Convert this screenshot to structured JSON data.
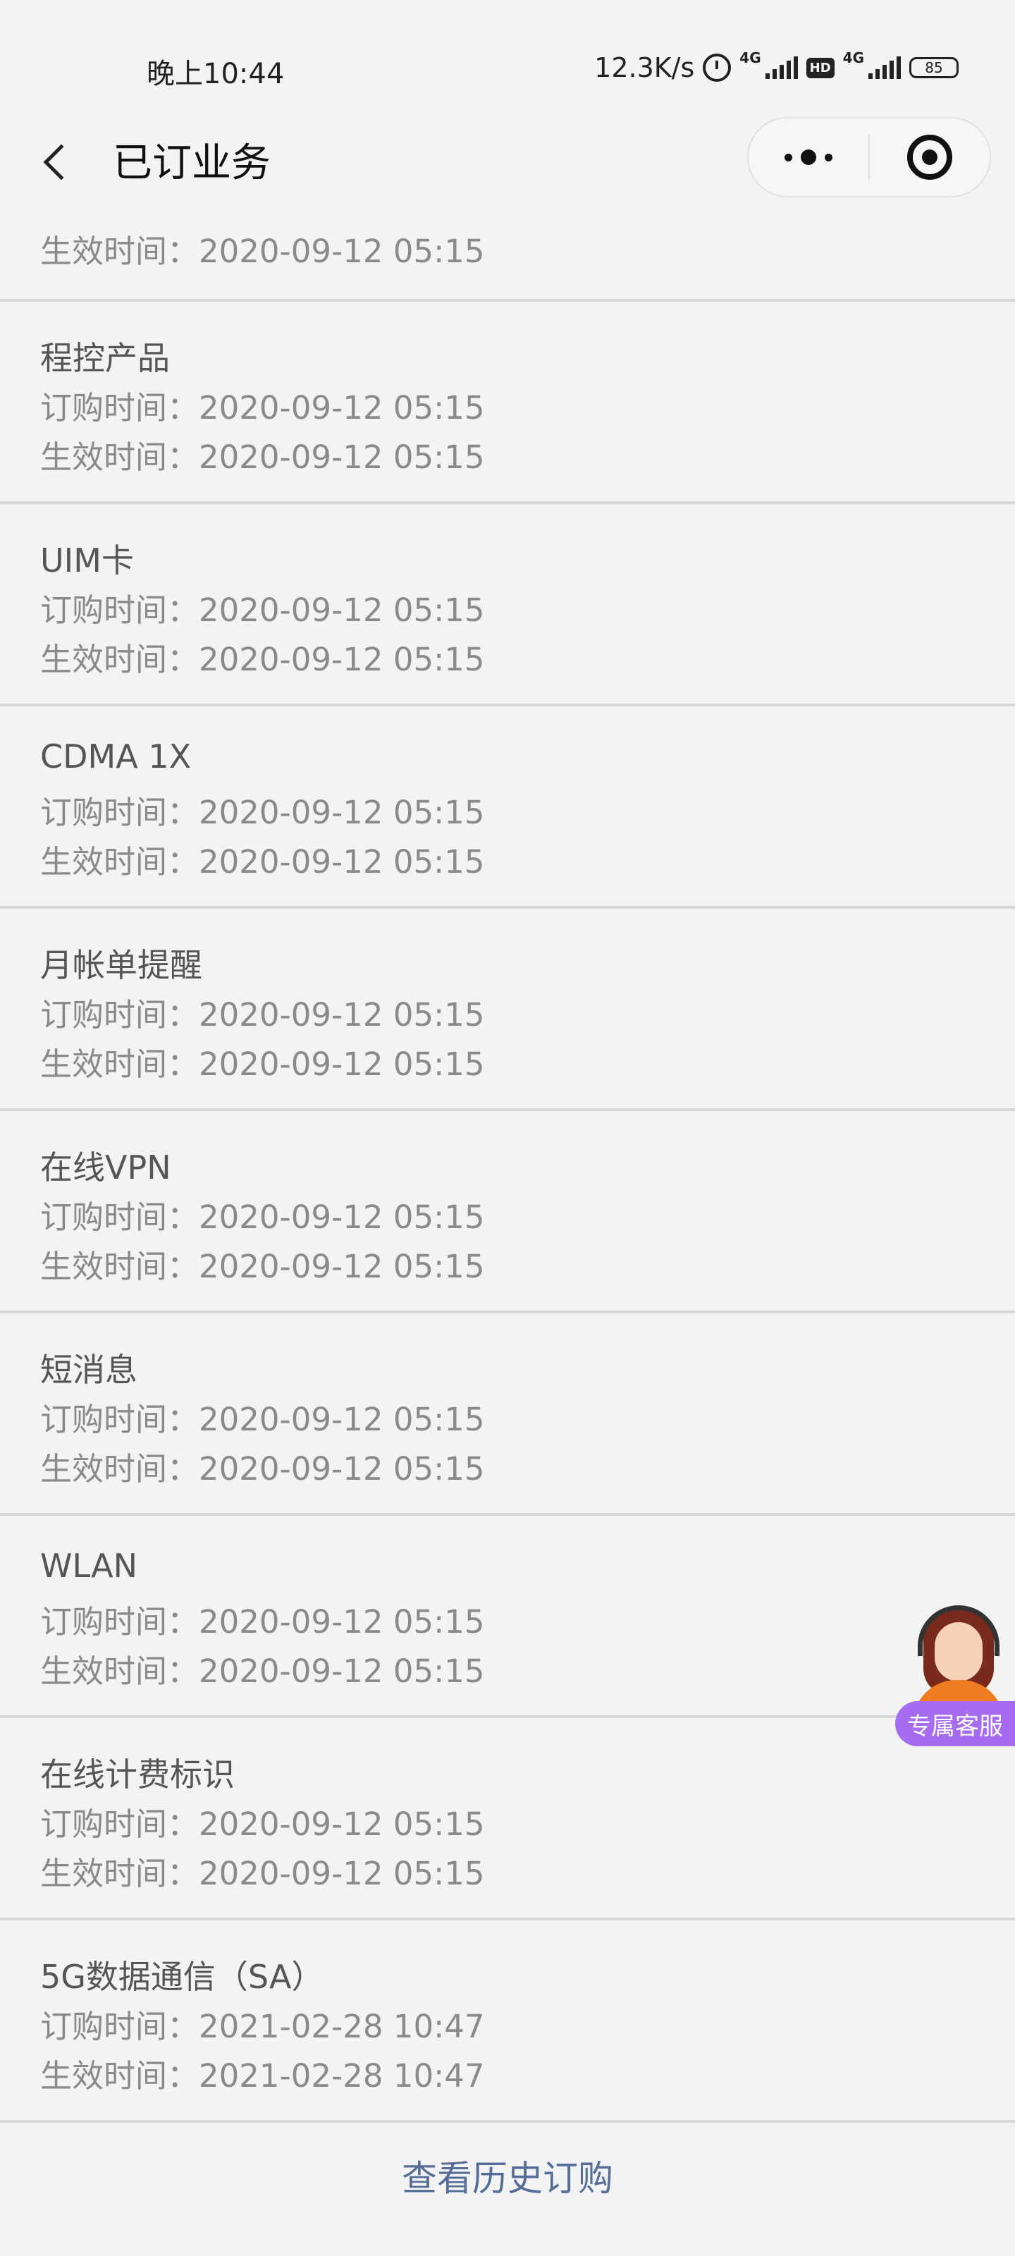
{
  "status_bar": {
    "time": "晚上10:44",
    "net_speed": "12.3K/s",
    "net_type_1": "4G",
    "hd": "HD",
    "net_type_2": "4G",
    "battery": "85"
  },
  "header": {
    "title": "已订业务"
  },
  "list": {
    "partial": {
      "effect": "生效时间：2020-09-12 05:15"
    },
    "items": [
      {
        "name": "程控产品",
        "order": "订购时间：2020-09-12 05:15",
        "effect": "生效时间：2020-09-12 05:15"
      },
      {
        "name": "UIM卡",
        "order": "订购时间：2020-09-12 05:15",
        "effect": "生效时间：2020-09-12 05:15"
      },
      {
        "name": "CDMA 1X",
        "order": "订购时间：2020-09-12 05:15",
        "effect": "生效时间：2020-09-12 05:15"
      },
      {
        "name": "月帐单提醒",
        "order": "订购时间：2020-09-12 05:15",
        "effect": "生效时间：2020-09-12 05:15"
      },
      {
        "name": "在线VPN",
        "order": "订购时间：2020-09-12 05:15",
        "effect": "生效时间：2020-09-12 05:15"
      },
      {
        "name": "短消息",
        "order": "订购时间：2020-09-12 05:15",
        "effect": "生效时间：2020-09-12 05:15"
      },
      {
        "name": "WLAN",
        "order": "订购时间：2020-09-12 05:15",
        "effect": "生效时间：2020-09-12 05:15"
      },
      {
        "name": "在线计费标识",
        "order": "订购时间：2020-09-12 05:15",
        "effect": "生效时间：2020-09-12 05:15"
      },
      {
        "name": "5G数据通信（SA）",
        "order": "订购时间：2021-02-28 10:47",
        "effect": "生效时间：2021-02-28 10:47"
      }
    ]
  },
  "footer": {
    "history_link": "查看历史订购"
  },
  "service": {
    "badge": "专属客服"
  },
  "colors": {
    "background": "#f3f3f3",
    "divider": "#d6d6d6",
    "link": "#566d97",
    "service_badge": "#a66cf0"
  }
}
